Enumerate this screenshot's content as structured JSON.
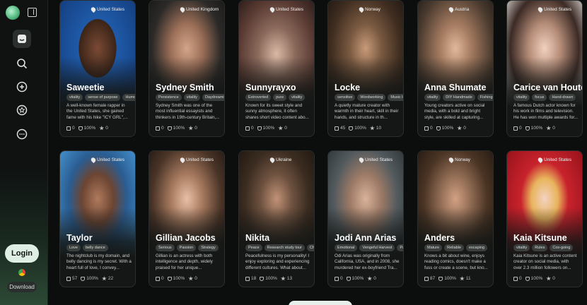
{
  "sidebar": {
    "login_label": "Login",
    "download_label": "Download",
    "nav": [
      {
        "icon": "chat-bubble-icon",
        "active": true
      },
      {
        "icon": "search-icon",
        "active": false
      },
      {
        "icon": "plus-icon",
        "active": false
      },
      {
        "icon": "star-badge-icon",
        "active": false
      },
      {
        "icon": "more-dots-icon",
        "active": false
      }
    ]
  },
  "cards": [
    {
      "country": "United States",
      "name": "Saweetie",
      "tags": [
        "vitality",
        "sense of purpose",
        "Humorous"
      ],
      "desc": "A well-known female rapper in the United States, she gained fame with his hike \"ICY GRL\",...",
      "chats": "0",
      "likes": "100%",
      "stars": "0"
    },
    {
      "country": "United Kingdom",
      "name": "Sydney Smith",
      "tags": [
        "Persistence",
        "vitality",
        "Daydreaming"
      ],
      "desc": "Sydney Smith was one of the most influential essayists and thinkers in 19th-century Britain,...",
      "chats": "0",
      "likes": "100%",
      "stars": "0"
    },
    {
      "country": "United States",
      "name": "Sunnyrayxo",
      "tags": [
        "Extroverted",
        "pure",
        "vitality"
      ],
      "desc": "Known for its sweet style and sunny atmosphere, it often shares short video content abo...",
      "chats": "0",
      "likes": "100%",
      "stars": "0"
    },
    {
      "country": "Norway",
      "name": "Locke",
      "tags": [
        "sensitive",
        "Wordworking",
        "Music lover"
      ],
      "desc": "A quietly mature creator with warmth in their heart, skill in their hands, and structure in th...",
      "chats": "45",
      "likes": "100%",
      "stars": "10"
    },
    {
      "country": "Austria",
      "name": "Anna Shumate",
      "tags": [
        "vitality",
        "DIY Handmade",
        "Fishing"
      ],
      "desc": "Young creators active on social media, with a bold and bright style, are skilled at capturing...",
      "chats": "0",
      "likes": "100%",
      "stars": "0"
    },
    {
      "country": "United States",
      "name": "Carice van Houten",
      "tags": [
        "vitality",
        "focus",
        "Hand-drawn"
      ],
      "desc": "A famous Dutch actor known for his work in films and television. He has won multiple awards for...",
      "chats": "0",
      "likes": "100%",
      "stars": "0"
    },
    {
      "country": "United States",
      "name": "Taylor",
      "tags": [
        "Love",
        "belly dance"
      ],
      "desc": "The nightclub is my domain, and belly dancing is my secret. With a heart full of love, I convey...",
      "chats": "57",
      "likes": "100%",
      "stars": "22"
    },
    {
      "country": "United States",
      "name": "Gillian Jacobs",
      "tags": [
        "Serious",
        "Passion",
        "Strategy"
      ],
      "desc": "Gillian is an actress with both intelligence and depth, widely praised for her unique...",
      "chats": "0",
      "likes": "100%",
      "stars": "0"
    },
    {
      "country": "Ukraine",
      "name": "Nikita",
      "tags": [
        "Peace",
        "Research study tour",
        "Chemistry"
      ],
      "desc": "Peacefulness is my personality! I enjoy exploring and experiencing different cultures. What about...",
      "chats": "18",
      "likes": "100%",
      "stars": "13"
    },
    {
      "country": "United States",
      "name": "Jodi Ann Arias",
      "tags": [
        "Emotional",
        "Vengeful Harvest",
        "Painting"
      ],
      "desc": "Odi Arias was originally from California, USA, and in 2008, she murdered her ex-boyfriend Tra...",
      "chats": "0",
      "likes": "100%",
      "stars": "0"
    },
    {
      "country": "Norway",
      "name": "Anders",
      "tags": [
        "Mature",
        "Reliable",
        "escaping"
      ],
      "desc": "Knows a bit about wine, enjoys reading comics, doesn't make a fuss or create a scene, but kno...",
      "chats": "87",
      "likes": "100%",
      "stars": "11"
    },
    {
      "country": "United States",
      "name": "Kaia Kitsune",
      "tags": [
        "vitality",
        "Rules",
        "Cos-going"
      ],
      "desc": "Kaia Kitsune is an active content creator on social media, with over 2.3 million followers on...",
      "chats": "0",
      "likes": "100%",
      "stars": "0"
    }
  ]
}
